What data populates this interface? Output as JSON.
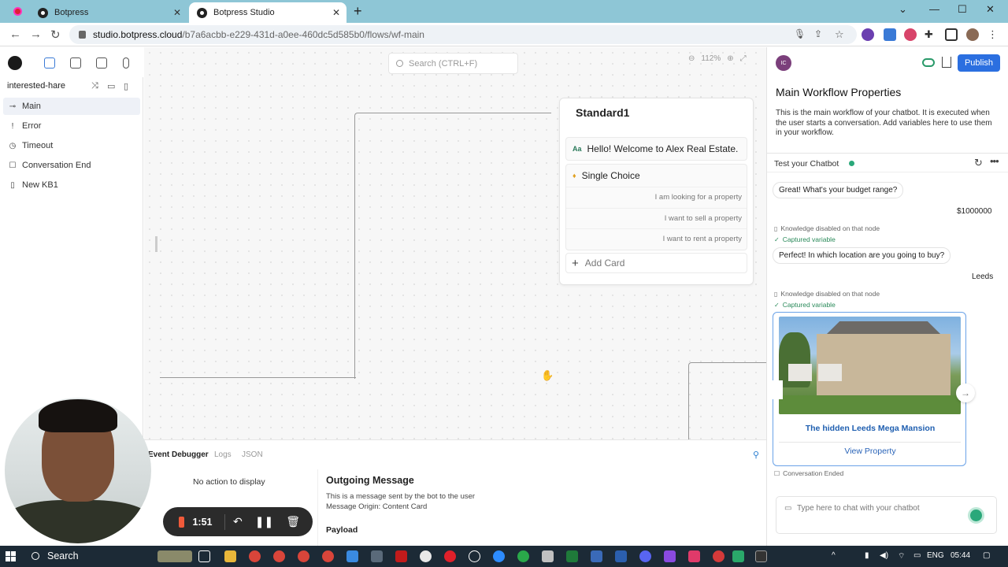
{
  "browser": {
    "tabs": [
      {
        "title": "Botpress",
        "active": false
      },
      {
        "title": "Botpress Studio",
        "active": true
      }
    ],
    "url_host": "studio.botpress.cloud",
    "url_path": "/b7a6acbb-e229-431d-a0ee-460dc5d585b0/flows/wf-main"
  },
  "sidebar": {
    "bot_name": "interested-hare",
    "flows": [
      {
        "label": "Main",
        "icon": "arrow-key-icon",
        "active": true
      },
      {
        "label": "Error",
        "icon": "exclamation-icon",
        "active": false
      },
      {
        "label": "Timeout",
        "icon": "clock-icon",
        "active": false
      },
      {
        "label": "Conversation End",
        "icon": "square-icon",
        "active": false
      },
      {
        "label": "New KB1",
        "icon": "book-icon",
        "active": false
      }
    ]
  },
  "canvas": {
    "search_placeholder": "Search (CTRL+F)",
    "zoom": "112%",
    "node": {
      "title": "Standard1",
      "text_card_prefix": "Aa",
      "text_card": "Hello! Welcome to Alex Real Estate.",
      "choice_card": "Single Choice",
      "choices": [
        "I am looking for a property",
        "I want to sell a property",
        "I want to rent a property"
      ],
      "add_card": "Add Card"
    }
  },
  "debugger": {
    "tabs": [
      "Event Debugger",
      "Logs",
      "JSON"
    ],
    "no_action": "No action to display",
    "title": "Outgoing Message",
    "desc": "This is a message sent by the bot to the user",
    "origin": "Message Origin: Content Card",
    "payload_label": "Payload"
  },
  "right_panel": {
    "avatar_initials": "IC",
    "publish": "Publish",
    "title": "Main Workflow Properties",
    "description": "This is the main workflow of your chatbot. It is executed when the user starts a conversation. Add variables here to use them in your workflow.",
    "test_label": "Test your Chatbot",
    "chat": {
      "bot_msg_1": "Great! What's your budget range?",
      "user_msg_1": "$1000000",
      "note_knowledge": "Knowledge disabled on that node",
      "note_captured": "Captured variable",
      "bot_msg_2": "Perfect! In which location are you going to buy?",
      "user_msg_2": "Leeds",
      "card_title": "The hidden Leeds Mega Mansion",
      "card_button": "View Property",
      "conversation_ended": "Conversation Ended",
      "input_placeholder": "Type here to chat with your chatbot"
    }
  },
  "recorder": {
    "time": "1:51"
  },
  "taskbar": {
    "search": "Search",
    "lang": "ENG",
    "clock": "05:44"
  },
  "colors": {
    "accent_blue": "#2b6fe0",
    "green": "#2aa87a",
    "tabbar": "#8ec6d6"
  }
}
